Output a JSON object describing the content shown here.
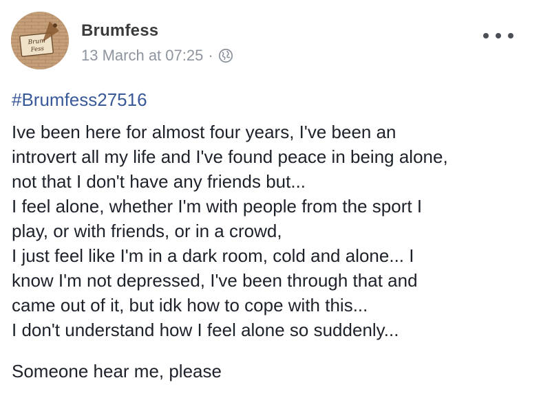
{
  "post": {
    "author": {
      "name": "Brumfess",
      "avatar_text": [
        "Brum",
        "Fess"
      ]
    },
    "timestamp": "13 March at 07:25",
    "separator": "·",
    "privacy_icon": "globe-icon",
    "more_icon": "ellipsis-icon",
    "hashtag": "#Brumfess27516",
    "body_lines": [
      "Ive been here for almost four years, I've been an",
      "introvert all my life and I've found peace in being alone,",
      "not that I don't have any friends but...",
      "I feel alone, whether I'm with people from the sport I",
      "play, or with friends, or in a crowd,",
      "I just feel like I'm in a dark room, cold and alone... I",
      "know I'm not depressed, I've been through that and",
      "came out of it, but idk how to cope with this...",
      "I don't understand how I feel alone so suddenly..."
    ],
    "closing": "Someone hear me, please"
  },
  "colors": {
    "link": "#385898",
    "text": "#1d2129",
    "meta": "#8d949e",
    "avatar_bg": "#c9a883"
  }
}
